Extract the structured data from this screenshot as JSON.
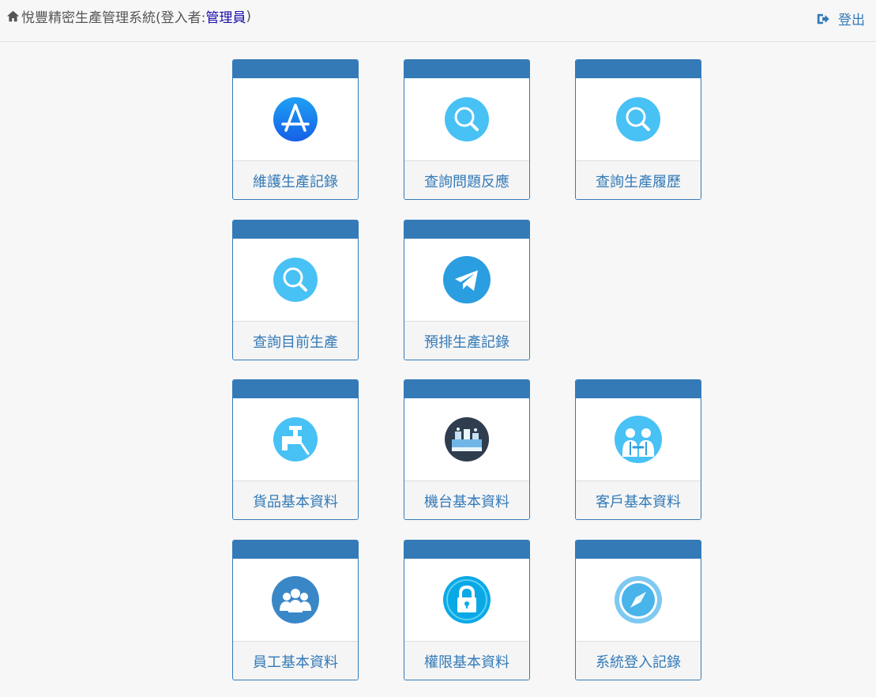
{
  "header": {
    "title_prefix": "悅豐精密生產管理系統(登入者:",
    "user": "管理員",
    "title_suffix": ")",
    "logout_label": "登出"
  },
  "colors": {
    "primary": "#337ab7",
    "icon_light_blue": "#48c1f5"
  },
  "tiles": [
    {
      "label": "維護生產記錄",
      "icon": "app-store-icon"
    },
    {
      "label": "查詢問題反應",
      "icon": "search-icon"
    },
    {
      "label": "查詢生產履歷",
      "icon": "search-icon"
    },
    {
      "label": "查詢目前生產",
      "icon": "search-icon"
    },
    {
      "label": "預排生產記錄",
      "icon": "telegram-icon"
    },
    {
      "label": "貨品基本資料",
      "icon": "faucet-icon"
    },
    {
      "label": "機台基本資料",
      "icon": "machine-icon"
    },
    {
      "label": "客戶基本資料",
      "icon": "handshake-icon"
    },
    {
      "label": "員工基本資料",
      "icon": "people-icon"
    },
    {
      "label": "權限基本資料",
      "icon": "lock-icon"
    },
    {
      "label": "系統登入記錄",
      "icon": "compass-icon"
    }
  ]
}
